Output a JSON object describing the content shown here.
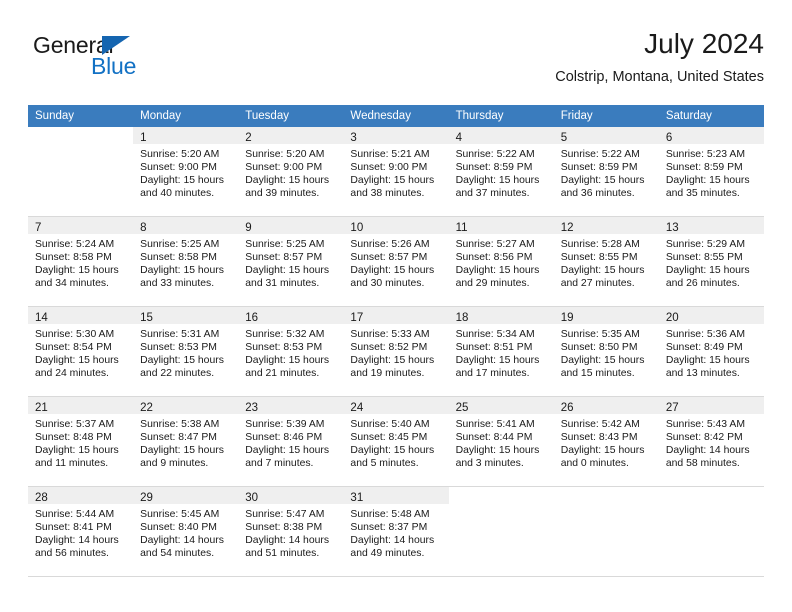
{
  "brand": {
    "name_part1": "General",
    "name_part2": "Blue",
    "accent_color": "#1271c4",
    "triangle_color": "#1565b0"
  },
  "header": {
    "title": "July 2024",
    "location": "Colstrip, Montana, United States"
  },
  "calendar": {
    "header_bg": "#3a7cbe",
    "weekday_headers": [
      "Sunday",
      "Monday",
      "Tuesday",
      "Wednesday",
      "Thursday",
      "Friday",
      "Saturday"
    ],
    "weeks": [
      [
        {
          "day": "",
          "empty": true
        },
        {
          "day": "1",
          "sunrise": "Sunrise: 5:20 AM",
          "sunset": "Sunset: 9:00 PM",
          "daylight_line1": "Daylight: 15 hours",
          "daylight_line2": "and 40 minutes."
        },
        {
          "day": "2",
          "sunrise": "Sunrise: 5:20 AM",
          "sunset": "Sunset: 9:00 PM",
          "daylight_line1": "Daylight: 15 hours",
          "daylight_line2": "and 39 minutes."
        },
        {
          "day": "3",
          "sunrise": "Sunrise: 5:21 AM",
          "sunset": "Sunset: 9:00 PM",
          "daylight_line1": "Daylight: 15 hours",
          "daylight_line2": "and 38 minutes."
        },
        {
          "day": "4",
          "sunrise": "Sunrise: 5:22 AM",
          "sunset": "Sunset: 8:59 PM",
          "daylight_line1": "Daylight: 15 hours",
          "daylight_line2": "and 37 minutes."
        },
        {
          "day": "5",
          "sunrise": "Sunrise: 5:22 AM",
          "sunset": "Sunset: 8:59 PM",
          "daylight_line1": "Daylight: 15 hours",
          "daylight_line2": "and 36 minutes."
        },
        {
          "day": "6",
          "sunrise": "Sunrise: 5:23 AM",
          "sunset": "Sunset: 8:59 PM",
          "daylight_line1": "Daylight: 15 hours",
          "daylight_line2": "and 35 minutes."
        }
      ],
      [
        {
          "day": "7",
          "sunrise": "Sunrise: 5:24 AM",
          "sunset": "Sunset: 8:58 PM",
          "daylight_line1": "Daylight: 15 hours",
          "daylight_line2": "and 34 minutes."
        },
        {
          "day": "8",
          "sunrise": "Sunrise: 5:25 AM",
          "sunset": "Sunset: 8:58 PM",
          "daylight_line1": "Daylight: 15 hours",
          "daylight_line2": "and 33 minutes."
        },
        {
          "day": "9",
          "sunrise": "Sunrise: 5:25 AM",
          "sunset": "Sunset: 8:57 PM",
          "daylight_line1": "Daylight: 15 hours",
          "daylight_line2": "and 31 minutes."
        },
        {
          "day": "10",
          "sunrise": "Sunrise: 5:26 AM",
          "sunset": "Sunset: 8:57 PM",
          "daylight_line1": "Daylight: 15 hours",
          "daylight_line2": "and 30 minutes."
        },
        {
          "day": "11",
          "sunrise": "Sunrise: 5:27 AM",
          "sunset": "Sunset: 8:56 PM",
          "daylight_line1": "Daylight: 15 hours",
          "daylight_line2": "and 29 minutes."
        },
        {
          "day": "12",
          "sunrise": "Sunrise: 5:28 AM",
          "sunset": "Sunset: 8:55 PM",
          "daylight_line1": "Daylight: 15 hours",
          "daylight_line2": "and 27 minutes."
        },
        {
          "day": "13",
          "sunrise": "Sunrise: 5:29 AM",
          "sunset": "Sunset: 8:55 PM",
          "daylight_line1": "Daylight: 15 hours",
          "daylight_line2": "and 26 minutes."
        }
      ],
      [
        {
          "day": "14",
          "sunrise": "Sunrise: 5:30 AM",
          "sunset": "Sunset: 8:54 PM",
          "daylight_line1": "Daylight: 15 hours",
          "daylight_line2": "and 24 minutes."
        },
        {
          "day": "15",
          "sunrise": "Sunrise: 5:31 AM",
          "sunset": "Sunset: 8:53 PM",
          "daylight_line1": "Daylight: 15 hours",
          "daylight_line2": "and 22 minutes."
        },
        {
          "day": "16",
          "sunrise": "Sunrise: 5:32 AM",
          "sunset": "Sunset: 8:53 PM",
          "daylight_line1": "Daylight: 15 hours",
          "daylight_line2": "and 21 minutes."
        },
        {
          "day": "17",
          "sunrise": "Sunrise: 5:33 AM",
          "sunset": "Sunset: 8:52 PM",
          "daylight_line1": "Daylight: 15 hours",
          "daylight_line2": "and 19 minutes."
        },
        {
          "day": "18",
          "sunrise": "Sunrise: 5:34 AM",
          "sunset": "Sunset: 8:51 PM",
          "daylight_line1": "Daylight: 15 hours",
          "daylight_line2": "and 17 minutes."
        },
        {
          "day": "19",
          "sunrise": "Sunrise: 5:35 AM",
          "sunset": "Sunset: 8:50 PM",
          "daylight_line1": "Daylight: 15 hours",
          "daylight_line2": "and 15 minutes."
        },
        {
          "day": "20",
          "sunrise": "Sunrise: 5:36 AM",
          "sunset": "Sunset: 8:49 PM",
          "daylight_line1": "Daylight: 15 hours",
          "daylight_line2": "and 13 minutes."
        }
      ],
      [
        {
          "day": "21",
          "sunrise": "Sunrise: 5:37 AM",
          "sunset": "Sunset: 8:48 PM",
          "daylight_line1": "Daylight: 15 hours",
          "daylight_line2": "and 11 minutes."
        },
        {
          "day": "22",
          "sunrise": "Sunrise: 5:38 AM",
          "sunset": "Sunset: 8:47 PM",
          "daylight_line1": "Daylight: 15 hours",
          "daylight_line2": "and 9 minutes."
        },
        {
          "day": "23",
          "sunrise": "Sunrise: 5:39 AM",
          "sunset": "Sunset: 8:46 PM",
          "daylight_line1": "Daylight: 15 hours",
          "daylight_line2": "and 7 minutes."
        },
        {
          "day": "24",
          "sunrise": "Sunrise: 5:40 AM",
          "sunset": "Sunset: 8:45 PM",
          "daylight_line1": "Daylight: 15 hours",
          "daylight_line2": "and 5 minutes."
        },
        {
          "day": "25",
          "sunrise": "Sunrise: 5:41 AM",
          "sunset": "Sunset: 8:44 PM",
          "daylight_line1": "Daylight: 15 hours",
          "daylight_line2": "and 3 minutes."
        },
        {
          "day": "26",
          "sunrise": "Sunrise: 5:42 AM",
          "sunset": "Sunset: 8:43 PM",
          "daylight_line1": "Daylight: 15 hours",
          "daylight_line2": "and 0 minutes."
        },
        {
          "day": "27",
          "sunrise": "Sunrise: 5:43 AM",
          "sunset": "Sunset: 8:42 PM",
          "daylight_line1": "Daylight: 14 hours",
          "daylight_line2": "and 58 minutes."
        }
      ],
      [
        {
          "day": "28",
          "sunrise": "Sunrise: 5:44 AM",
          "sunset": "Sunset: 8:41 PM",
          "daylight_line1": "Daylight: 14 hours",
          "daylight_line2": "and 56 minutes."
        },
        {
          "day": "29",
          "sunrise": "Sunrise: 5:45 AM",
          "sunset": "Sunset: 8:40 PM",
          "daylight_line1": "Daylight: 14 hours",
          "daylight_line2": "and 54 minutes."
        },
        {
          "day": "30",
          "sunrise": "Sunrise: 5:47 AM",
          "sunset": "Sunset: 8:38 PM",
          "daylight_line1": "Daylight: 14 hours",
          "daylight_line2": "and 51 minutes."
        },
        {
          "day": "31",
          "sunrise": "Sunrise: 5:48 AM",
          "sunset": "Sunset: 8:37 PM",
          "daylight_line1": "Daylight: 14 hours",
          "daylight_line2": "and 49 minutes."
        },
        {
          "day": "",
          "empty": true
        },
        {
          "day": "",
          "empty": true
        },
        {
          "day": "",
          "empty": true
        }
      ]
    ]
  }
}
